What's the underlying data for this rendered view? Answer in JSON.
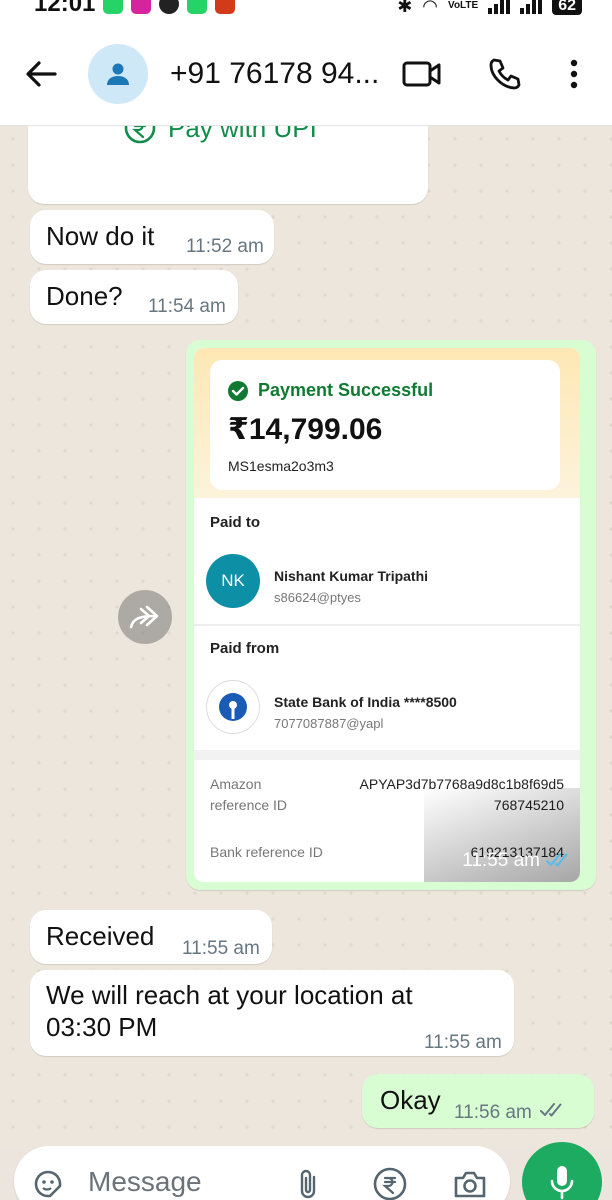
{
  "status_bar": {
    "time": "12:01",
    "network": "VoLTE",
    "battery": "62"
  },
  "header": {
    "contact_name": "+91 76178 94..."
  },
  "messages": {
    "upi_label": "Pay with UPI",
    "m1": {
      "text": "Now do it",
      "time": "11:52 am"
    },
    "m2": {
      "text": "Done?",
      "time": "11:54 am"
    },
    "payment": {
      "status": "Payment Successful",
      "amount": "₹14,799.06",
      "txn_id": "MS1esma2o3m3",
      "paid_to_label": "Paid to",
      "payee_initials": "NK",
      "payee_name": "Nishant Kumar Tripathi",
      "payee_id": "s86624@ptyes",
      "paid_from_label": "Paid from",
      "payer_bank": "State Bank of India ****8500",
      "payer_id": "7077087887@yapl",
      "amazon_ref_label_1": "Amazon",
      "amazon_ref_label_2": "reference ID",
      "amazon_ref_value_1": "APYAP3d7b7768a9d8c1b8f69d5",
      "amazon_ref_value_2": "768745210",
      "bank_ref_label": "Bank reference ID",
      "bank_ref_value": "619213137184",
      "time": "11:55 am"
    },
    "m3": {
      "text": "Received",
      "time": "11:55 am"
    },
    "m4": {
      "text_1": "We will reach at your location at",
      "text_2": "03:30 PM",
      "time": "11:55 am"
    },
    "m5": {
      "text": "Okay",
      "time": "11:56 am"
    }
  },
  "input": {
    "placeholder": "Message"
  },
  "colors": {
    "accent_green": "#1daa61",
    "outgoing_bubble": "#d9fdd3",
    "success_green": "#107a32",
    "payee_circle": "#0d8fa6",
    "read_tick": "#53bdeb"
  }
}
